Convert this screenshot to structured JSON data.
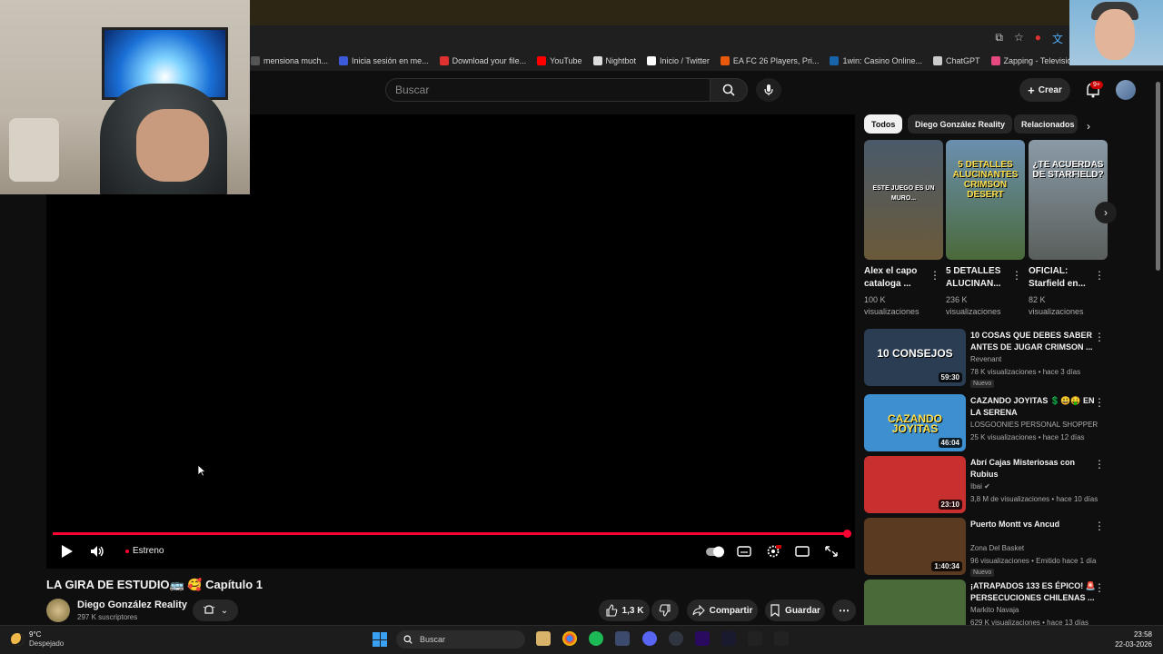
{
  "browser": {
    "bookmarks": [
      {
        "label": "mensiona much...",
        "color": "#555555"
      },
      {
        "label": "Inicia sesión en me...",
        "color": "#3b5bdb"
      },
      {
        "label": "Download your file...",
        "color": "#e03131"
      },
      {
        "label": "YouTube",
        "color": "#ff0000"
      },
      {
        "label": "Nightbot",
        "color": "#dddddd"
      },
      {
        "label": "Inicio / Twitter",
        "color": "#ffffff"
      },
      {
        "label": "EA FC 26 Players, Pri...",
        "color": "#e8590c"
      },
      {
        "label": "1win: Casino Online...",
        "color": "#1864ab"
      },
      {
        "label": "ChatGPT",
        "color": "#cccccc"
      },
      {
        "label": "Zapping - Televisión...",
        "color": "#e64980"
      }
    ],
    "bookmarks_more": "»"
  },
  "header": {
    "search_placeholder": "Buscar",
    "create_label": "Crear",
    "notif_badge": "9+"
  },
  "player": {
    "status_label": "Estreno"
  },
  "video": {
    "title": "LA GIRA DE ESTUDIO🚌 🥰 Capítulo 1",
    "channel_name": "Diego González Reality",
    "subscribers": "297 K suscriptores",
    "likes": "1,3 K",
    "share_label": "Compartir",
    "save_label": "Guardar"
  },
  "chips": [
    {
      "label": "Todos",
      "active": true
    },
    {
      "label": "Diego González Reality",
      "active": false
    },
    {
      "label": "Relacionados",
      "active": false
    }
  ],
  "shorts": [
    {
      "title": "Alex el capo cataloga ...",
      "views": "100 K visualizaciones",
      "overlay": "ESTE JUEGO ES UN MURO...",
      "color_top": "#4a5a6a",
      "color_bottom": "#6b5a3a"
    },
    {
      "title": "5 DETALLES ALUCINAN...",
      "views": "236 K visualizaciones",
      "overlay": "5 DETALLES ALUCINANTES CRIMSON DESERT",
      "color_top": "#6b8fb0",
      "color_bottom": "#4a6a3a"
    },
    {
      "title": "OFICIAL: Starfield en...",
      "views": "82 K visualizaciones",
      "overlay": "¿TE ACUERDAS DE STARFIELD?",
      "color_top": "#8a9aa6",
      "color_bottom": "#5a5f5c"
    }
  ],
  "related": [
    {
      "title": "10 COSAS QUE DEBES SABER ANTES DE JUGAR CRIMSON ...",
      "channel": "Revenant",
      "meta": "78 K visualizaciones • hace 3 días",
      "badge": "Nuevo",
      "duration": "59:30",
      "thumb_text": "10 CONSEJOS",
      "color": "#2a3d52"
    },
    {
      "title": "CAZANDO JOYITAS 💲😃🤑 EN LA SERENA",
      "channel": "LOSGOONIES PERSONAL SHOPPER",
      "meta": "25 K visualizaciones • hace 12 días",
      "badge": "",
      "duration": "46:04",
      "thumb_text": "CAZANDO JOYITAS",
      "color": "#3d8fd0"
    },
    {
      "title": "Abrí Cajas Misteriosas con Rubius",
      "channel": "Ibai ✔",
      "meta": "3,8 M de visualizaciones • hace 10 días",
      "badge": "",
      "duration": "23:10",
      "thumb_text": "",
      "color": "#c7302e"
    },
    {
      "title": "Puerto Montt vs Ancud",
      "channel": "Zona Del Basket",
      "meta": "96 visualizaciones • Emitido hace 1 día",
      "badge": "Nuevo",
      "duration": "1:40:34",
      "thumb_text": "",
      "color": "#5a3a20"
    },
    {
      "title": "¡ATRAPADOS 133 ES ÉPICO! 🚨 PERSECUCIONES CHILENAS ...",
      "channel": "Markito Navaja",
      "meta": "629 K visualizaciones • hace 13 días",
      "badge": "",
      "duration": "",
      "thumb_text": "",
      "color": "#4a6a3a"
    }
  ],
  "taskbar": {
    "temp": "9°C",
    "condition": "Despejado",
    "search_label": "Buscar",
    "time": "23:58",
    "date": "22-03-2026"
  }
}
